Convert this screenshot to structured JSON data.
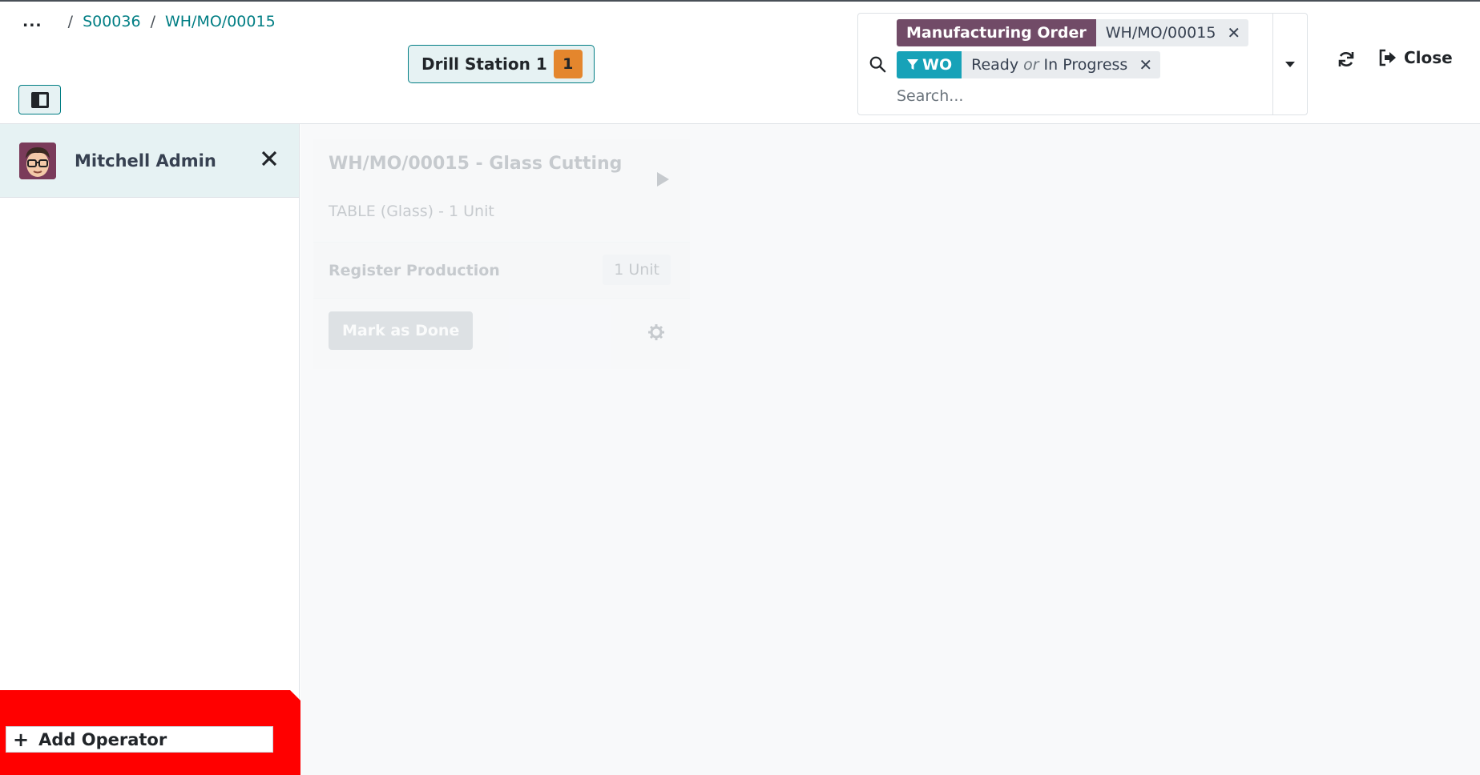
{
  "breadcrumb": {
    "dots": "...",
    "items": [
      "S00036",
      "WH/MO/00015"
    ]
  },
  "workstation": {
    "name": "Drill Station 1",
    "count": "1"
  },
  "search": {
    "facets": [
      {
        "label": "Manufacturing Order",
        "values": [
          "WH/MO/00015"
        ]
      },
      {
        "label": "WO",
        "values": [
          "Ready",
          "In Progress"
        ],
        "separator": "or"
      }
    ],
    "placeholder": "Search..."
  },
  "header_actions": {
    "close_label": "Close"
  },
  "sidebar": {
    "operator": {
      "name": "Mitchell Admin"
    },
    "add_operator_label": "Add Operator"
  },
  "workorder": {
    "title": "WH/MO/00015 - Glass Cutting",
    "product": "TABLE (Glass) - 1 Unit",
    "step_label": "Register Production",
    "step_qty": "1 Unit",
    "done_label": "Mark as Done"
  },
  "colors": {
    "accent": "#017e84",
    "facet_purple": "#714b67",
    "facet_teal": "#17a2b8",
    "badge": "#e4862d",
    "highlight": "#ff0000"
  }
}
